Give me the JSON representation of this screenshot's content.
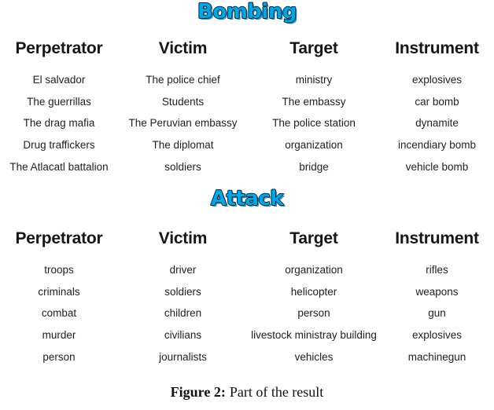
{
  "figure": {
    "caption_label": "Figure 2:",
    "caption_text": "Part of the result",
    "title_color": "#00A6E7",
    "outline_color": "#1b1b1b",
    "text_color": "#1f1f1f"
  },
  "sections": [
    {
      "title": "Bombing",
      "columns": [
        "Perpetrator",
        "Victim",
        "Target",
        "Instrument"
      ],
      "rows": [
        [
          "El salvador",
          "The police chief",
          "ministry",
          "explosives"
        ],
        [
          "The guerrillas",
          "Students",
          "The embassy",
          "car bomb"
        ],
        [
          "The drag mafia",
          "The Peruvian embassy",
          "The police station",
          "dynamite"
        ],
        [
          "Drug traffickers",
          "The diplomat",
          "organization",
          "incendiary bomb"
        ],
        [
          "The Atlacatl battalion",
          "soldiers",
          "bridge",
          "vehicle bomb"
        ]
      ]
    },
    {
      "title": "Attack",
      "columns": [
        "Perpetrator",
        "Victim",
        "Target",
        "Instrument"
      ],
      "rows": [
        [
          "troops",
          "driver",
          "organization",
          "rifles"
        ],
        [
          "criminals",
          "soldiers",
          "helicopter",
          "weapons"
        ],
        [
          "combat",
          "children",
          "person",
          "gun"
        ],
        [
          "murder",
          "civilians",
          "livestock ministray building",
          "explosives"
        ],
        [
          "person",
          "journalists",
          "vehicles",
          "machinegun"
        ]
      ]
    }
  ]
}
